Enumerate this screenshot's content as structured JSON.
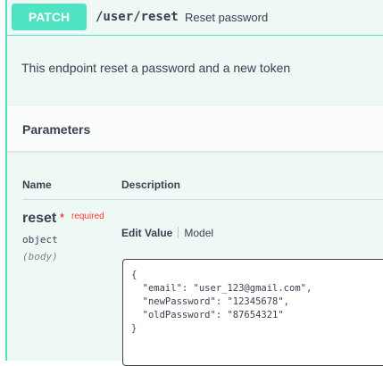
{
  "operation": {
    "method": "PATCH",
    "path": "/user/reset",
    "summary": "Reset password",
    "description": "This endpoint reset a password and a new token"
  },
  "parameters": {
    "title": "Parameters",
    "columns": {
      "name": "Name",
      "description": "Description"
    },
    "items": [
      {
        "name": "reset",
        "required_marker": "*",
        "required_label": "required",
        "type": "object",
        "in": "(body)",
        "tabs": {
          "edit_value": "Edit Value",
          "model": "Model"
        },
        "value": "{\n  \"email\": \"user_123@gmail.com\",\n  \"newPassword\": \"12345678\",\n  \"oldPassword\": \"87654321\"\n}"
      }
    ]
  },
  "colors": {
    "method_patch": "#50e3c2",
    "required": "#ff0000",
    "text": "#3b4151"
  }
}
